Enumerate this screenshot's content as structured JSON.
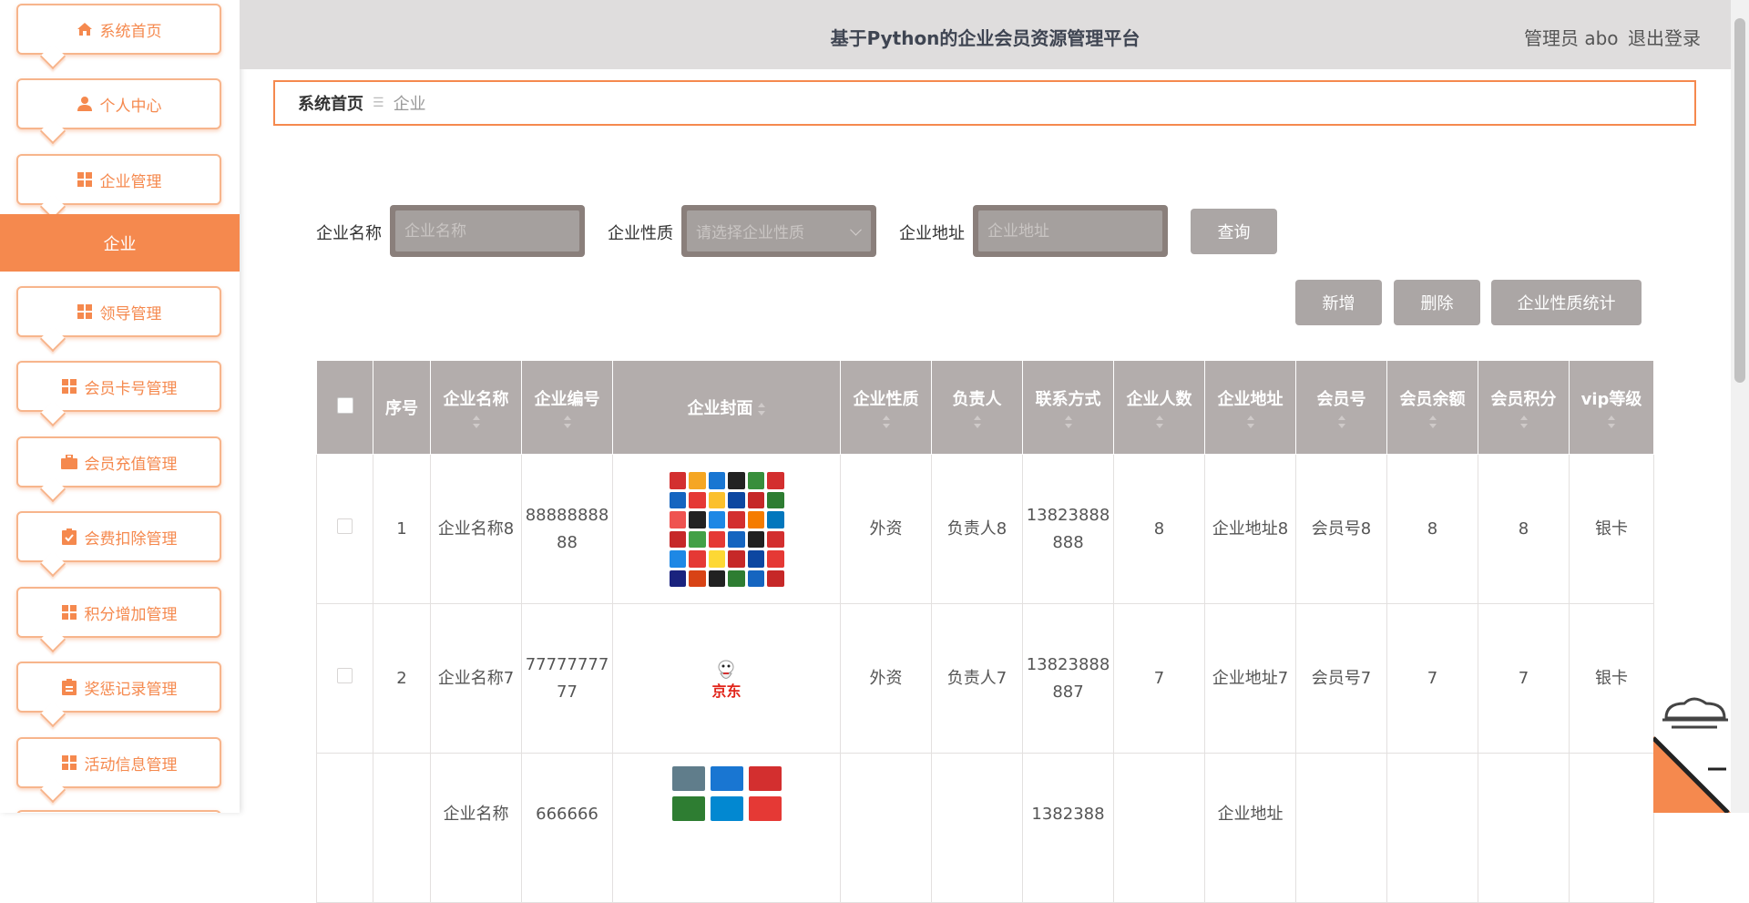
{
  "header": {
    "title": "基于Python的企业会员资源管理平台",
    "user": "管理员 abo",
    "logout": "退出登录"
  },
  "sidebar": {
    "items": [
      {
        "label": "系统首页",
        "icon": "home-icon"
      },
      {
        "label": "个人中心",
        "icon": "user-icon"
      },
      {
        "label": "企业管理",
        "icon": "grid-icon"
      },
      {
        "label": "领导管理",
        "icon": "grid-icon"
      },
      {
        "label": "会员卡号管理",
        "icon": "grid-icon"
      },
      {
        "label": "会员充值管理",
        "icon": "briefcase-icon"
      },
      {
        "label": "会费扣除管理",
        "icon": "clipboard-check-icon"
      },
      {
        "label": "积分增加管理",
        "icon": "grid-icon"
      },
      {
        "label": "奖惩记录管理",
        "icon": "clipboard-icon"
      },
      {
        "label": "活动信息管理",
        "icon": "grid-icon"
      }
    ],
    "active": "企业"
  },
  "breadcrumb": {
    "home": "系统首页",
    "current": "企业"
  },
  "search": {
    "name_label": "企业名称",
    "name_placeholder": "企业名称",
    "type_label": "企业性质",
    "type_placeholder": "请选择企业性质",
    "address_label": "企业地址",
    "address_placeholder": "企业地址",
    "query_button": "查询"
  },
  "actions": {
    "add": "新增",
    "delete": "删除",
    "stats": "企业性质统计"
  },
  "table": {
    "headers": [
      "序号",
      "企业名称",
      "企业编号",
      "企业封面",
      "企业性质",
      "负责人",
      "联系方式",
      "企业人数",
      "企业地址",
      "会员号",
      "会员余额",
      "会员积分",
      "vip等级"
    ],
    "rows": [
      {
        "index": "1",
        "name": "企业名称8",
        "code": "8888888888",
        "type": "外资",
        "leader": "负责人8",
        "phone": "13823888888",
        "count": "8",
        "address": "企业地址8",
        "member": "会员号8",
        "balance": "8",
        "points": "8",
        "vip": "银卡"
      },
      {
        "index": "2",
        "name": "企业名称7",
        "code": "7777777777",
        "type": "外资",
        "leader": "负责人7",
        "phone": "13823888887",
        "count": "7",
        "address": "企业地址7",
        "member": "会员号7",
        "balance": "7",
        "points": "7",
        "vip": "银卡"
      },
      {
        "index": "",
        "name": "企业名称",
        "code": "666666",
        "type": "",
        "leader": "",
        "phone": "1382388",
        "count": "",
        "address": "企业地址",
        "member": "",
        "balance": "",
        "points": "",
        "vip": ""
      }
    ],
    "cover_row2_text": "京东"
  },
  "colors": {
    "accent": "#f5894e",
    "header_bg": "#dfdddd",
    "table_header": "#b3adac",
    "button": "#aba6a5"
  }
}
